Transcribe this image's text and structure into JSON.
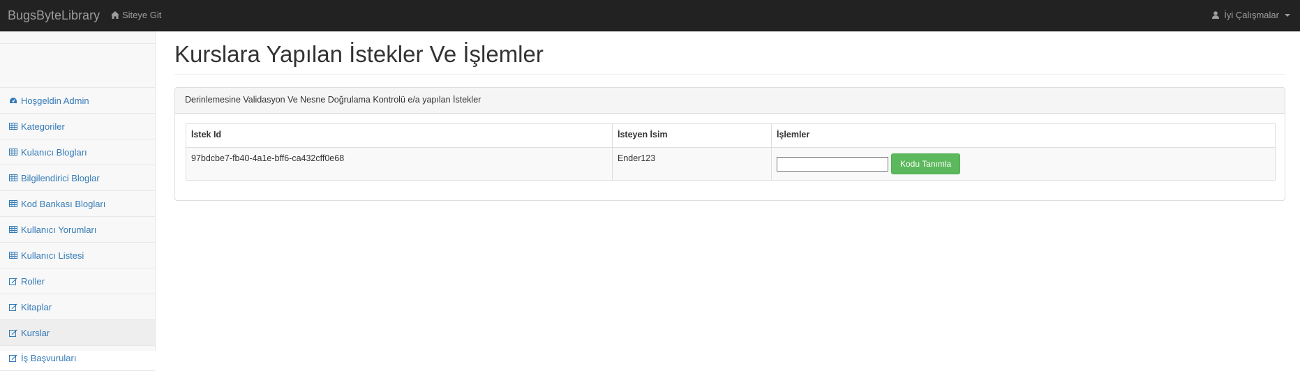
{
  "navbar": {
    "brand": "BugsByteLibrary",
    "site_link": "Siteye Git",
    "site_link_icon": "home-icon",
    "user_menu": "İyi Çalışmalar",
    "user_icon": "user-icon"
  },
  "sidebar": {
    "items": [
      {
        "label": "Hoşgeldin Admin",
        "icon": "dashboard-icon"
      },
      {
        "label": "Kategoriler",
        "icon": "table-icon"
      },
      {
        "label": "Kulanıcı Blogları",
        "icon": "table-icon"
      },
      {
        "label": "Bilgilendirici Bloglar",
        "icon": "table-icon"
      },
      {
        "label": "Kod Bankası Blogları",
        "icon": "table-icon"
      },
      {
        "label": "Kullanıcı Yorumları",
        "icon": "table-icon"
      },
      {
        "label": "Kullanıcı Listesi",
        "icon": "table-icon"
      },
      {
        "label": "Roller",
        "icon": "edit-icon"
      },
      {
        "label": "Kitaplar",
        "icon": "edit-icon"
      },
      {
        "label": "Kurslar",
        "icon": "edit-icon"
      },
      {
        "label": "İş Başvuruları",
        "icon": "edit-icon"
      }
    ],
    "active_item": "Kurslar"
  },
  "main": {
    "title": "Kurslara Yapılan İstekler Ve İşlemler",
    "panel_heading": "Derinlemesine Validasyon Ve Nesne Doğrulama Kontrolü e/a yapılan İstekler",
    "table": {
      "headers": [
        "İstek Id",
        "İsteyen İsim",
        "İşlemler"
      ],
      "rows": [
        {
          "id": "97bdcbe7-fb40-4a1e-bff6-ca432cff0e68",
          "name": "Ender123",
          "input_value": "",
          "button_label": "Kodu Tanımla"
        }
      ]
    }
  },
  "colors": {
    "navbar_bg": "#222222",
    "link": "#337ab7",
    "success": "#5cb85c",
    "sidebar_bg": "#f8f8f8"
  }
}
